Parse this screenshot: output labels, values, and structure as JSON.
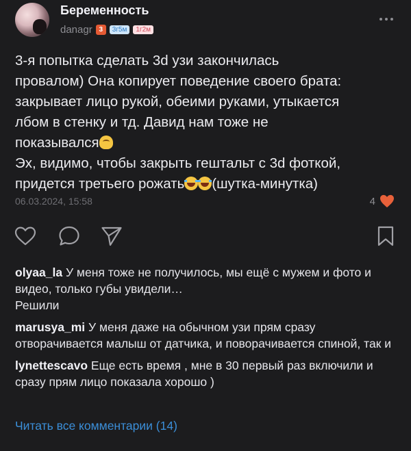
{
  "header": {
    "group_name": "Беременность",
    "author": "danagr",
    "badge_level": "3",
    "badge_boy": "3г5м",
    "badge_girl": "1г2м"
  },
  "post": {
    "line1": "3-я попытка сделать 3d узи закончилась",
    "line2": "провалом) Она копирует поведение своего брата:",
    "line3": "закрывает лицо рукой, обеими руками, утыкается",
    "line4": "лбом в стенку и тд. Давид нам тоже не",
    "line5": "показывался",
    "line6": "Эх, видимо, чтобы закрыть гештальт с 3d фоткой,",
    "line7a": "придется третьего рожать",
    "line7b": "(шутка-минутка)",
    "timestamp": "06.03.2024, 15:58",
    "likes": "4"
  },
  "icons": {
    "like": "heart-outline-icon",
    "comment": "speech-bubble-icon",
    "share": "send-arrow-icon",
    "bookmark": "bookmark-icon",
    "liked": "heart-filled-icon",
    "more": "more-dots-icon"
  },
  "colors": {
    "background": "#1c1c1e",
    "accent_link": "#3b8ed8",
    "heart": "#e8613a"
  },
  "comments": [
    {
      "author": "olyaa_la",
      "text": "У меня тоже не получилось, мы ещё с мужем и фото и видео, только губы увидели…",
      "extra": "Решили"
    },
    {
      "author": "marusya_mi",
      "text": "У меня даже на обычном узи прям сразу отворачивается малыш от датчика, и поворачивается спиной, так и"
    },
    {
      "author": "lynettescavo",
      "text": "Еще есть время , мне в 30 первый раз включили и сразу прям лицо показала хорошо )"
    }
  ],
  "read_all_label": "Читать все комментарии (14)"
}
